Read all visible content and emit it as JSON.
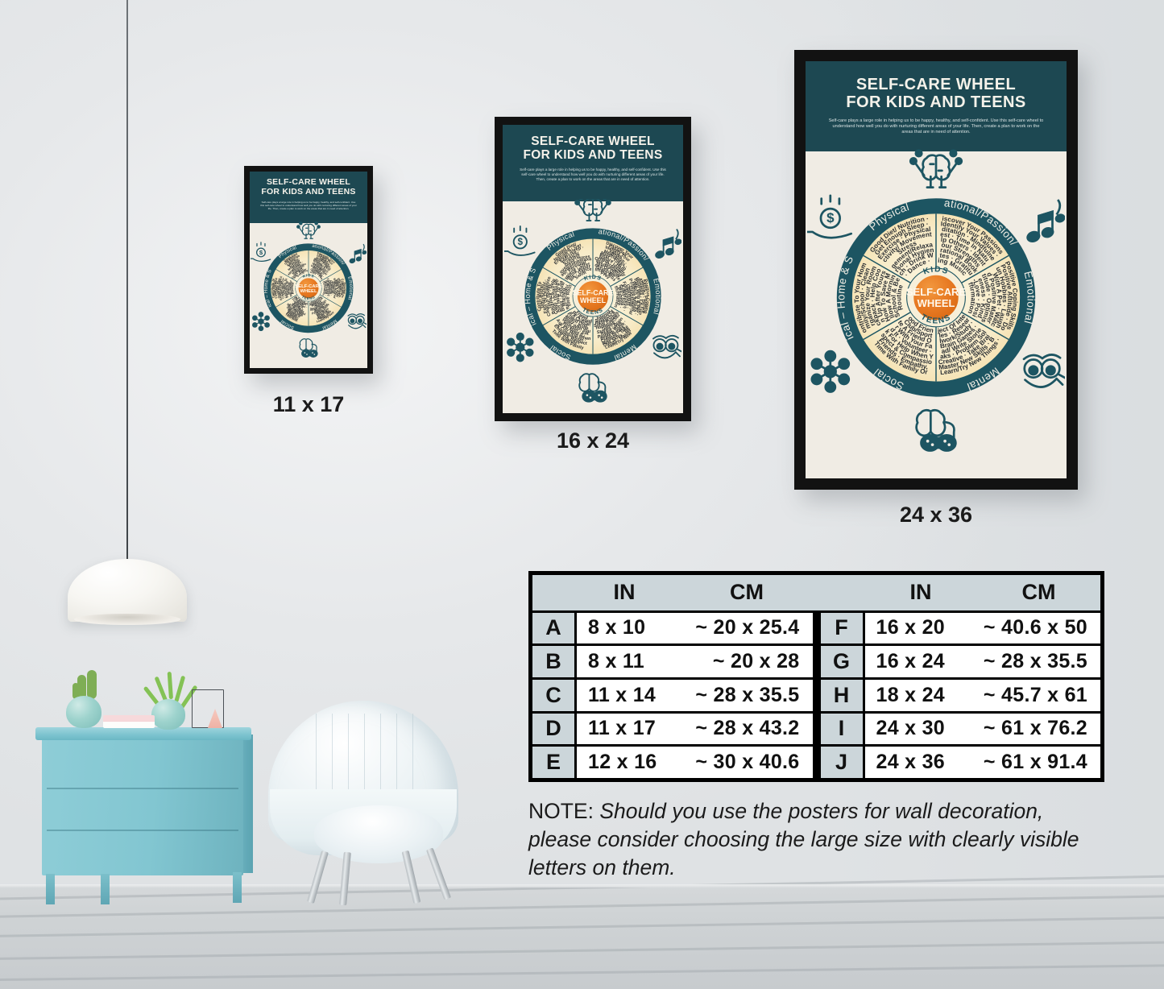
{
  "scene": {
    "description": "Interior wall mockup showing three framed Self-Care Wheel posters above a size chart"
  },
  "posters": [
    {
      "id": "small",
      "size_label": "11 x 17"
    },
    {
      "id": "medium",
      "size_label": "16 x 24"
    },
    {
      "id": "large",
      "size_label": "24 x 36"
    }
  ],
  "poster": {
    "title_line1": "SELF-CARE WHEEL",
    "title_line2": "FOR KIDS AND TEENS",
    "subtitle": "Self-care plays a large role in helping us to be happy, healthy, and self-confident. Use this self-care wheel to understand how well you do with nurturing different areas of your life. Then, create a plan to work on the areas that are in need of attention.",
    "hub": {
      "top_label": "KIDS",
      "bottom_label": "TEENS",
      "center_line1": "SELF-CARE",
      "center_line2": "WHEEL"
    },
    "segments": [
      {
        "name": "Physical",
        "items": "Good Diet/ Nutrition · Get Enough Sleep · Exercise · Physical Activity/ Movement · Stress Management/Relaxation · Personal Hygiene · Stretch · Drink Water · Walk · Dance · Swim"
      },
      {
        "name": "Inspirational/Passion/Spirit",
        "items": "Discover Your Passions · Identify Your Values · Meditation · Mindfulness · Rest · Time In Nature · Help Others · Identify Your Strengths · Inspirational Books Or Quotes · Gratitude · Uplifting Music · Pray"
      },
      {
        "name": "Emotional",
        "items": "Positive Coping Skills · Positive Attitude · Do Fun Hobbies · Laugh · Play With A Pet · Watch & Read Positive Material · Gratitude · Optimism · Forgiveness · Kindness · Self-Love · Positive Affirmations"
      },
      {
        "name": "Mental",
        "items": "Learn/Try New Things · Master New Skills · Be Creative · Take Brain Breaks · Problem Solve · Read/ Write Stories · Brain Games · Schoolwork/Study · Solve Puzzles · Research A Subject Of Interest"
      },
      {
        "name": "Social",
        "items": "Time With Family Or Friends · Empathy, Respect & Compassion · Ask For Help When You Need It · Volunteer · Eat Dinner With Your Family · Invite A Friend Over · Join A Club/Sport · Be A Good Friend"
      },
      {
        "name": "Practical – Home & School",
        "items": "Contribute To Your Home/ Family/School · Clean Or Organize Your Room/ Backpack · Help Cook · Clean Up After Yourself · Learn How To Save Money · Follow A Morning, After-School & Bedtime Routine"
      }
    ],
    "icons": [
      {
        "name": "hand-holding-coin-icon",
        "position": "top-left"
      },
      {
        "name": "brain-lifting-weights-icon",
        "position": "top-center"
      },
      {
        "name": "music-notes-icon",
        "position": "top-right"
      },
      {
        "name": "social-network-icon",
        "position": "bottom-left"
      },
      {
        "name": "brain-game-controller-icon",
        "position": "bottom-center"
      },
      {
        "name": "smiling-face-icon",
        "position": "bottom-right"
      }
    ],
    "colors": {
      "header_teal": "#1d4852",
      "ring_teal": "#1d5562",
      "paper_cream": "#f0ece4",
      "segment_cream": "#f6edcf",
      "hub_orange": "#e87722"
    }
  },
  "size_table": {
    "headers": [
      "IN",
      "CM",
      "IN",
      "CM"
    ],
    "left_rows": [
      {
        "letter": "A",
        "in": "8 x 10",
        "cm": "~  20 x 25.4"
      },
      {
        "letter": "B",
        "in": "8 x 11",
        "cm": "~  20 x 28"
      },
      {
        "letter": "C",
        "in": "11 x 14",
        "cm": "~  28 x 35.5"
      },
      {
        "letter": "D",
        "in": "11 x 17",
        "cm": "~  28 x 43.2"
      },
      {
        "letter": "E",
        "in": "12 x 16",
        "cm": "~  30 x 40.6"
      }
    ],
    "right_rows": [
      {
        "letter": "F",
        "in": "16 x 20",
        "cm": "~  40.6 x 50"
      },
      {
        "letter": "G",
        "in": "16 x 24",
        "cm": "~  28 x 35.5"
      },
      {
        "letter": "H",
        "in": "18 x 24",
        "cm": "~  45.7 x 61"
      },
      {
        "letter": "I",
        "in": "24 x 30",
        "cm": "~  61 x 76.2"
      },
      {
        "letter": "J",
        "in": "24 x 36",
        "cm": "~  61 x 91.4"
      }
    ]
  },
  "note": {
    "prefix": "NOTE:",
    "text": "Should you use the posters for wall decoration, please consider choosing the large size with clearly visible letters on them."
  }
}
